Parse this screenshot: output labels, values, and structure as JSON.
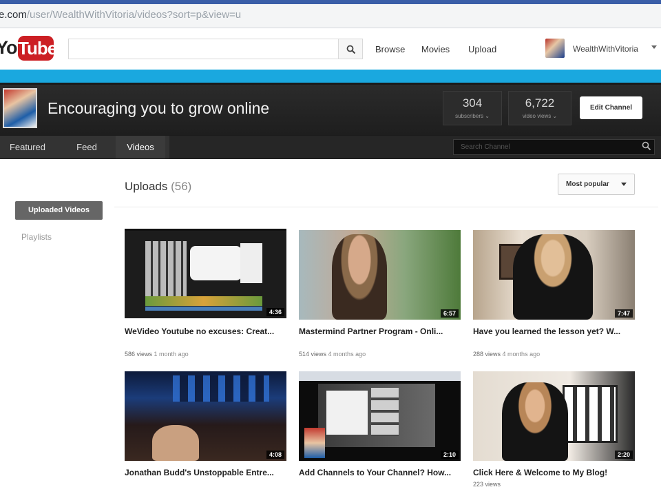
{
  "browser": {
    "url_prefix": "e.com",
    "url_path": "/user/WealthWithVitoria/videos?sort=p&view=u"
  },
  "header": {
    "logo_you": "You",
    "logo_tube": "Tube",
    "search_placeholder": "",
    "nav": [
      "Browse",
      "Movies",
      "Upload"
    ],
    "username": "WealthWithVitoria"
  },
  "channel": {
    "title": "Encouraging you to grow online",
    "subscribers": {
      "value": "304",
      "label": "subscribers ⌄"
    },
    "views": {
      "value": "6,722",
      "label": "video views ⌄"
    },
    "edit_label": "Edit Channel",
    "tabs": [
      "Featured",
      "Feed",
      "Videos"
    ],
    "active_tab": "Videos",
    "search_placeholder": "Search Channel"
  },
  "sidebar": {
    "items": [
      "Uploaded Videos",
      "Playlists"
    ]
  },
  "uploads": {
    "label": "Uploads",
    "count": "(56)",
    "sort_label": "Most popular"
  },
  "videos": [
    {
      "title": "WeVideo Youtube no excuses: Creat...",
      "duration": "4:36",
      "views": "586 views",
      "age": "1 month ago"
    },
    {
      "title": "Mastermind Partner Program - Onli...",
      "duration": "6:57",
      "views": "514 views",
      "age": "4 months ago"
    },
    {
      "title": "Have you learned the lesson yet? W...",
      "duration": "7:47",
      "views": "288 views",
      "age": "4 months ago"
    },
    {
      "title": "Jonathan Budd's Unstoppable Entre...",
      "duration": "4:08",
      "views": "",
      "age": ""
    },
    {
      "title": "Add Channels to Your Channel? How...",
      "duration": "2:10",
      "views": "",
      "age": ""
    },
    {
      "title": "Click Here & Welcome to My Blog!",
      "duration": "2:20",
      "views": "223 views",
      "age": ""
    }
  ],
  "colors": {
    "accent_band": "#1aa8df",
    "logo_red": "#cc1f24",
    "channel_bg": "#1b1b1b"
  }
}
